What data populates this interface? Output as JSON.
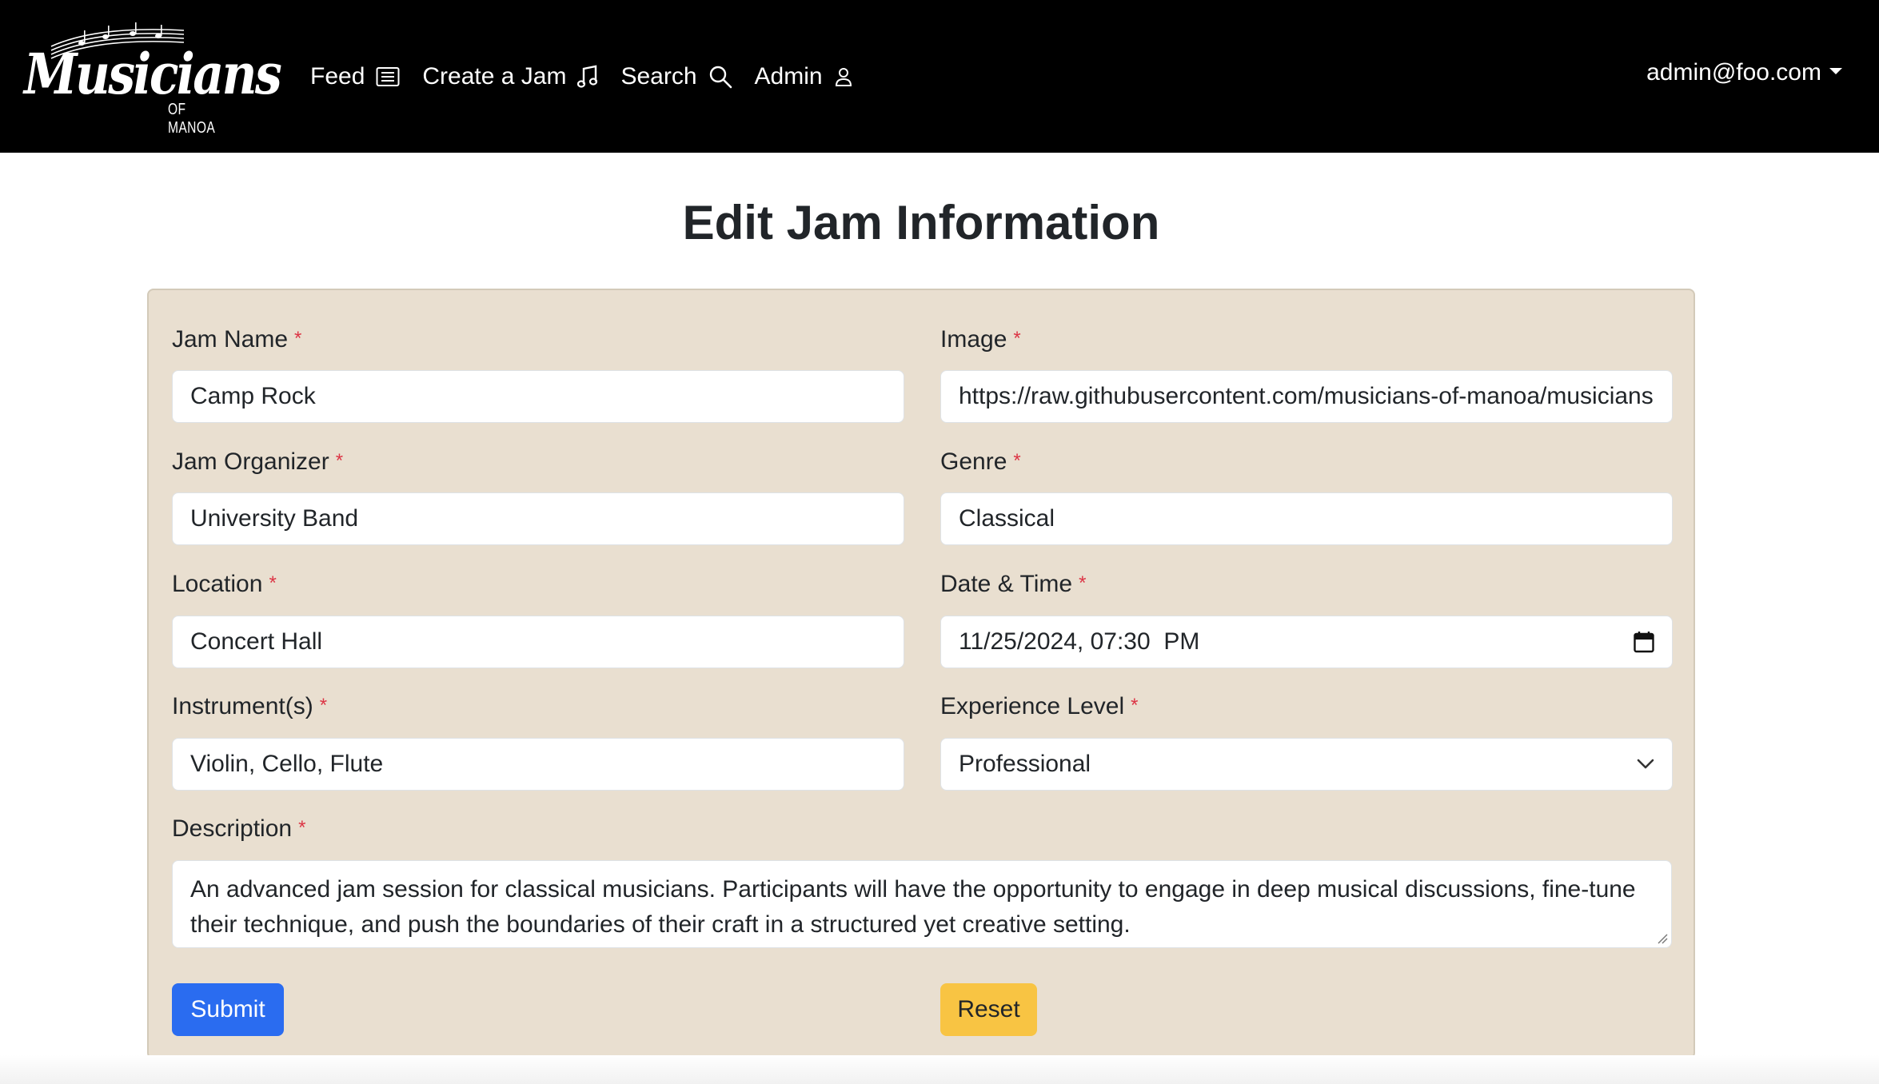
{
  "brand": {
    "name": "Musicians",
    "subtitle": "OF MANOA"
  },
  "nav": {
    "links": [
      {
        "label": "Feed",
        "icon": "list-icon"
      },
      {
        "label": "Create a Jam",
        "icon": "music-note-icon"
      },
      {
        "label": "Search",
        "icon": "search-icon"
      },
      {
        "label": "Admin",
        "icon": "person-icon"
      }
    ],
    "user": "admin@foo.com"
  },
  "page": {
    "title": "Edit Jam Information"
  },
  "form": {
    "required_mark": "*",
    "jam_name": {
      "label": "Jam Name",
      "value": "Camp Rock"
    },
    "image": {
      "label": "Image",
      "value": "https://raw.githubusercontent.com/musicians-of-manoa/musicians-of-manoa"
    },
    "organizer": {
      "label": "Jam Organizer",
      "value": "University Band"
    },
    "genre": {
      "label": "Genre",
      "value": "Classical"
    },
    "location": {
      "label": "Location",
      "value": "Concert Hall"
    },
    "datetime": {
      "label": "Date & Time",
      "value": "11/25/2024, 07:30  PM"
    },
    "instruments": {
      "label": "Instrument(s)",
      "value": "Violin, Cello, Flute"
    },
    "experience": {
      "label": "Experience Level",
      "value": "Professional"
    },
    "description": {
      "label": "Description",
      "value": "An advanced jam session for classical musicians. Participants will have the opportunity to engage in deep musical discussions, fine-tune their technique, and push the boundaries of their craft in a structured yet creative setting."
    },
    "submit_label": "Submit",
    "reset_label": "Reset"
  },
  "colors": {
    "navbar": "#000000",
    "card": "#e9dfd0",
    "submit": "#2a6cf0",
    "reset": "#f8c443",
    "required": "#dc3545"
  }
}
